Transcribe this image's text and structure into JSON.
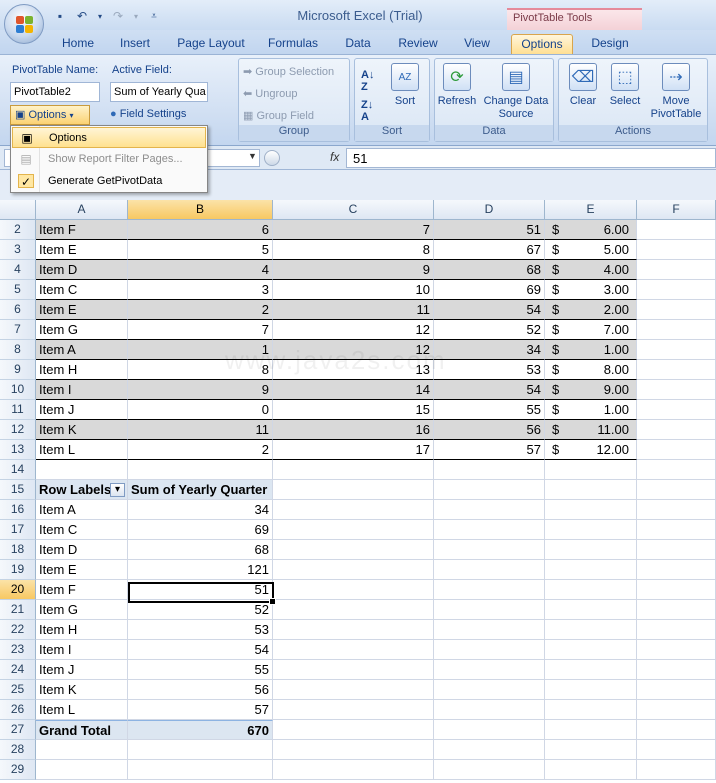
{
  "window": {
    "app_title": "Microsoft Excel (Trial)",
    "context_title": "PivotTable Tools"
  },
  "tabs": [
    "Home",
    "Insert",
    "Page Layout",
    "Formulas",
    "Data",
    "Review",
    "View",
    "Options",
    "Design"
  ],
  "active_tab": "Options",
  "ribbon": {
    "pivottable_name_label": "PivotTable Name:",
    "pivottable_name_value": "PivotTable2",
    "options_button": "Options",
    "active_field_label": "Active Field:",
    "active_field_value": "Sum of Yearly Qua",
    "field_settings": "Field Settings",
    "group_selection": "Group Selection",
    "ungroup": "Ungroup",
    "group_field": "Group Field",
    "group_label": "Group",
    "sort_button": "Sort",
    "sort_label": "Sort",
    "refresh": "Refresh",
    "change_data_source": "Change Data Source",
    "data_label": "Data",
    "clear": "Clear",
    "select": "Select",
    "move_pivottable": "Move PivotTable",
    "actions_label": "Actions"
  },
  "menu": {
    "items": [
      {
        "label": "Options",
        "enabled": true,
        "highlighted": true
      },
      {
        "label": "Show Report Filter Pages...",
        "enabled": false
      },
      {
        "label": "Generate GetPivotData",
        "enabled": true,
        "checked": true
      }
    ]
  },
  "formula_bar": {
    "fx": "fx",
    "value": "51"
  },
  "watermark": "www.java2s.com",
  "grid": {
    "columns": [
      "A",
      "B",
      "C",
      "D",
      "E",
      "F"
    ],
    "rows": [
      {
        "n": "2",
        "a": "Item F",
        "b": "6",
        "c": "7",
        "d": "51",
        "cur": "$",
        "e": "6.00"
      },
      {
        "n": "3",
        "a": "Item E",
        "b": "5",
        "c": "8",
        "d": "67",
        "cur": "$",
        "e": "5.00"
      },
      {
        "n": "4",
        "a": "Item D",
        "b": "4",
        "c": "9",
        "d": "68",
        "cur": "$",
        "e": "4.00"
      },
      {
        "n": "5",
        "a": "Item C",
        "b": "3",
        "c": "10",
        "d": "69",
        "cur": "$",
        "e": "3.00"
      },
      {
        "n": "6",
        "a": "Item E",
        "b": "2",
        "c": "11",
        "d": "54",
        "cur": "$",
        "e": "2.00"
      },
      {
        "n": "7",
        "a": "Item G",
        "b": "7",
        "c": "12",
        "d": "52",
        "cur": "$",
        "e": "7.00"
      },
      {
        "n": "8",
        "a": "Item A",
        "b": "1",
        "c": "12",
        "d": "34",
        "cur": "$",
        "e": "1.00"
      },
      {
        "n": "9",
        "a": "Item H",
        "b": "8",
        "c": "13",
        "d": "53",
        "cur": "$",
        "e": "8.00"
      },
      {
        "n": "10",
        "a": "Item I",
        "b": "9",
        "c": "14",
        "d": "54",
        "cur": "$",
        "e": "9.00"
      },
      {
        "n": "11",
        "a": "Item J",
        "b": "0",
        "c": "15",
        "d": "55",
        "cur": "$",
        "e": "1.00"
      },
      {
        "n": "12",
        "a": "Item K",
        "b": "11",
        "c": "16",
        "d": "56",
        "cur": "$",
        "e": "11.00"
      },
      {
        "n": "13",
        "a": "Item L",
        "b": "2",
        "c": "17",
        "d": "57",
        "cur": "$",
        "e": "12.00"
      },
      {
        "n": "14"
      },
      {
        "n": "15",
        "a": "Row Labels",
        "b": "Sum of Yearly Quarter",
        "kind": "pv-head"
      },
      {
        "n": "16",
        "a": "Item A",
        "b": "34"
      },
      {
        "n": "17",
        "a": "Item C",
        "b": "69"
      },
      {
        "n": "18",
        "a": "Item D",
        "b": "68"
      },
      {
        "n": "19",
        "a": "Item E",
        "b": "121"
      },
      {
        "n": "20",
        "a": "Item F",
        "b": "51"
      },
      {
        "n": "21",
        "a": "Item G",
        "b": "52"
      },
      {
        "n": "22",
        "a": "Item H",
        "b": "53"
      },
      {
        "n": "23",
        "a": "Item I",
        "b": "54"
      },
      {
        "n": "24",
        "a": "Item J",
        "b": "55"
      },
      {
        "n": "25",
        "a": "Item K",
        "b": "56"
      },
      {
        "n": "26",
        "a": "Item L",
        "b": "57"
      },
      {
        "n": "27",
        "a": "Grand Total",
        "b": "670",
        "kind": "pv-total"
      },
      {
        "n": "28"
      },
      {
        "n": "29"
      }
    ],
    "selected_row": "20",
    "selected_col": "B"
  }
}
